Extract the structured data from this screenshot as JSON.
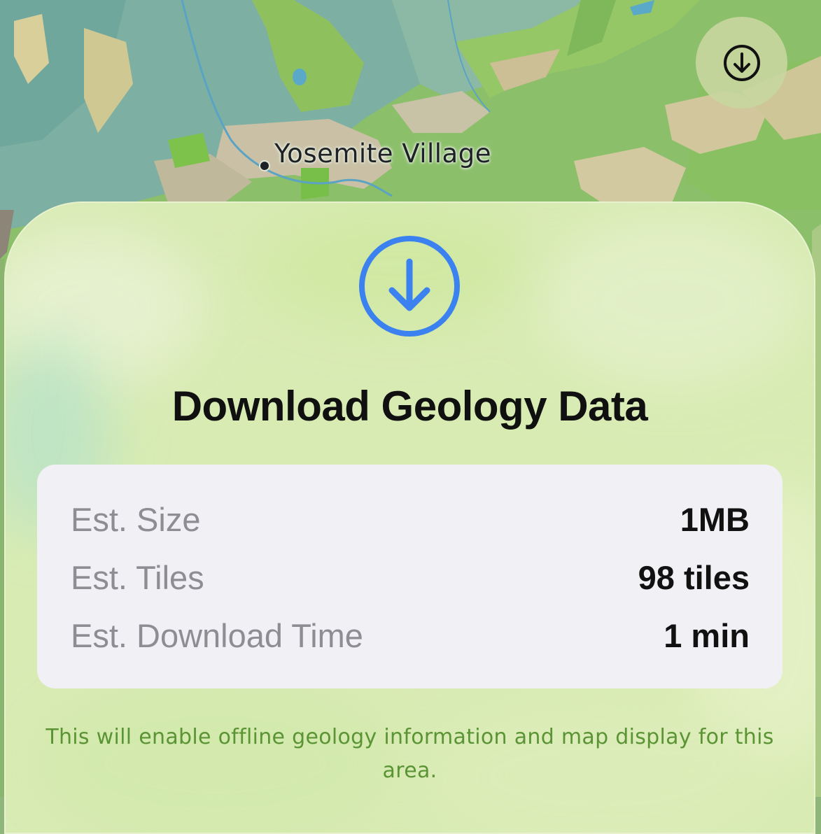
{
  "map": {
    "place_label": "Yosemite Village",
    "download_button_icon": "arrow-down-circle-icon"
  },
  "sheet": {
    "icon": "arrow-down-circle-icon",
    "title": "Download Geology Data",
    "rows": [
      {
        "label": "Est. Size",
        "value": "1MB"
      },
      {
        "label": "Est. Tiles",
        "value": "98 tiles"
      },
      {
        "label": "Est. Download Time",
        "value": "1 min"
      }
    ],
    "footnote": "This will enable offline geology information and map display for this area."
  },
  "colors": {
    "accent_blue": "#3b82f0",
    "footnote_green": "#5b9434",
    "card_background": "#f1f0f5"
  }
}
